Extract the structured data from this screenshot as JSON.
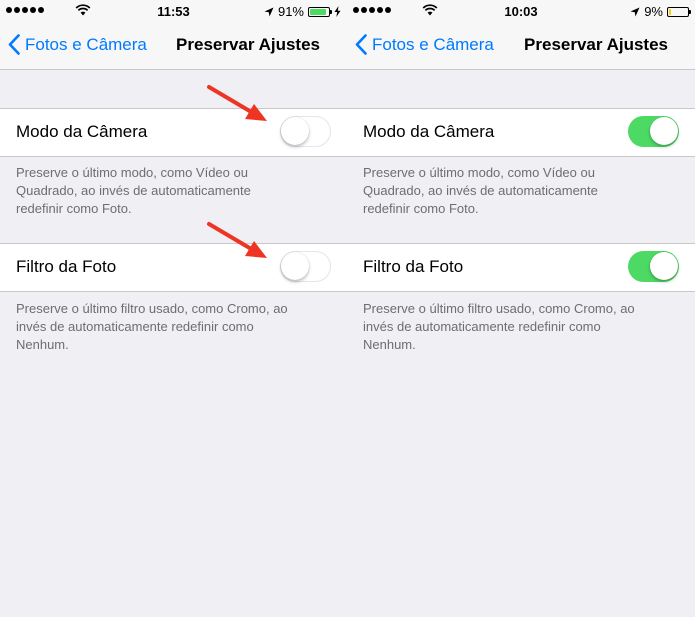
{
  "panels": [
    {
      "status": {
        "time": "11:53",
        "battery": "91%",
        "battery_level": 0.91,
        "battery_color": "#4cd964",
        "charging": true
      },
      "nav": {
        "back_label": "Fotos e Câmera",
        "title": "Preservar Ajustes"
      },
      "settings": [
        {
          "label": "Modo da Câmera",
          "on": false,
          "footer": [
            "Preserve o último modo, como Vídeo ou",
            "Quadrado, ao invés de automaticamente",
            "redefinir como Foto."
          ]
        },
        {
          "label": "Filtro da Foto",
          "on": false,
          "footer": [
            "Preserve o último filtro usado, como Cromo, ao",
            "invés de automaticamente redefinir como",
            "Nenhum."
          ]
        }
      ],
      "annotation": {
        "icon": "red-arrow-icon",
        "color": "#ee3524"
      }
    },
    {
      "status": {
        "time": "10:03",
        "battery": "9%",
        "battery_level": 0.09,
        "battery_color": "#ffcc00",
        "charging": false
      },
      "nav": {
        "back_label": "Fotos e Câmera",
        "title": "Preservar Ajustes"
      },
      "settings": [
        {
          "label": "Modo da Câmera",
          "on": true,
          "footer": [
            "Preserve o último modo, como Vídeo ou",
            "Quadrado, ao invés de automaticamente",
            "redefinir como Foto."
          ]
        },
        {
          "label": "Filtro da Foto",
          "on": true,
          "footer": [
            "Preserve o último filtro usado, como Cromo, ao",
            "invés de automaticamente redefinir como",
            "Nenhum."
          ]
        }
      ]
    }
  ],
  "colors": {
    "accent": "#007aff",
    "switch_on": "#4cd964",
    "switch_off_border": "#e5e5ea"
  }
}
